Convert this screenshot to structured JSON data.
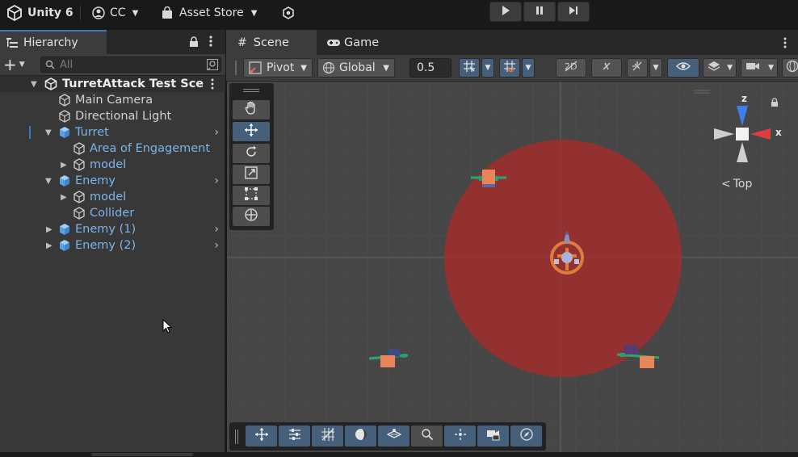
{
  "topbar": {
    "app_title": "Unity 6",
    "account": "CC",
    "asset_store": "Asset Store"
  },
  "hierarchy": {
    "tab_label": "Hierarchy",
    "search_placeholder": "All",
    "scene_name": "TurretAttack Test Scene",
    "items": [
      {
        "label": "Main Camera"
      },
      {
        "label": "Directional Light"
      },
      {
        "label": "Turret"
      },
      {
        "label": "Area of Engagement"
      },
      {
        "label": "model"
      },
      {
        "label": "Enemy"
      },
      {
        "label": "model"
      },
      {
        "label": "Collider"
      },
      {
        "label": "Enemy (1)"
      },
      {
        "label": "Enemy (2)"
      }
    ]
  },
  "scene": {
    "tabs": [
      {
        "label": "Scene"
      },
      {
        "label": "Game"
      }
    ],
    "pivot_label": "Pivot",
    "global_label": "Global",
    "snap_value": "0.5",
    "gizmo": {
      "x_label": "x",
      "z_label": "z",
      "view_label": "Top"
    }
  },
  "colors": {
    "accent": "#3a79bb",
    "active_tool": "#46607c",
    "prefab_text": "#7cb4ea",
    "engagement_area": "#a52c2c",
    "viewport_bg": "#464646"
  }
}
